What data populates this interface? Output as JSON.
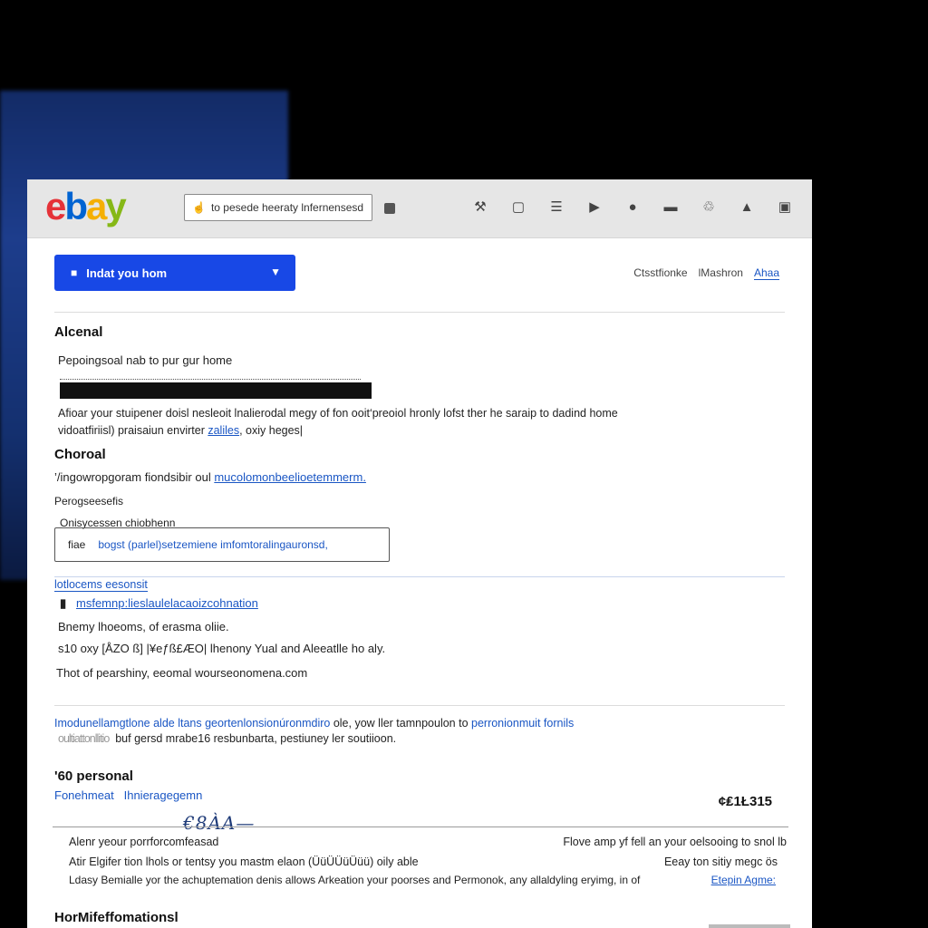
{
  "header": {
    "logo_letters": [
      "e",
      "b",
      "a",
      "y"
    ],
    "search_placeholder": "to pesede heeraty lnfernensesd",
    "icons": [
      "tools-icon",
      "screen-icon",
      "menu-icon",
      "folder-icon",
      "globe-icon",
      "mail-icon",
      "share-icon",
      "bell-icon",
      "cart-icon"
    ]
  },
  "toolbar": {
    "primary_button": "Indat you hom",
    "links": [
      "Ctsstfionke",
      "lMashron",
      "Ahaa"
    ]
  },
  "section1": {
    "heading": "Alcenal",
    "line1": "Pepoingsoal nab to pur gur home",
    "para_line1": "Afioar your stuipener doisl nesleoit lnalierodal megy of fon ooit‘preoiol hronly lofst ther he saraip to dadind home",
    "para_line2_a": "vidoatfiriisl) praisaiun envirter ",
    "para_line2_link": "zaliles",
    "para_line2_b": ", oxiy heges|"
  },
  "section2": {
    "heading": "Choroal",
    "line1_a": "’/ingowropgoram fiondsibir oul ",
    "line1_link": "mucolomonbeelioetemmerm.",
    "line2": "Perogseesefis",
    "line3": "Onisycessen chiobhenn",
    "input_prefix": "fiae",
    "input_value": "bogst (parlel)setzemiene imfomtoralingauronsd,"
  },
  "section3": {
    "title_link": "lotlocems eesonsit",
    "item_link": "msfemnp:lieslaulelacaoizcohnation",
    "line1": "Bnemy  lhoeoms, of erasma oliie.",
    "line2": "s10 oxy  [ÅZO ß]  |¥eƒß£ÆO|  lhenony Yual and Aleeatlle ho aly.",
    "line3": "Thot of pearshiny, eeomal wourseonomena.com"
  },
  "section4": {
    "line1_link": "Imodunellamgtlone alde ltans geortenlonsionúronmdiro",
    "line1_mid": " ole, yow ller tamnpoulon to ",
    "line1_link2": "perronionmuit fornils",
    "line2_prefix": "oultiattonllitio",
    "line2": "buf gersd mrabe16 resbunbarta, pestiuney ler soutiioon."
  },
  "section5": {
    "heading": "'60 personal",
    "sub_link1": "Fonehmeat",
    "sub_link2": "Ihnieragegemn",
    "price": "¢₤1Ł315",
    "signature": "€8ÀA—",
    "row1_left": "Alenr yeour porrforcomfeasad",
    "row1_right": "Flove amp yf fell an your oelsooing to snol lb",
    "row2_left": "Atir Elgifer tion lhols or tentsy you mastm elaon  (ÜüÜÜüÜüü) oily able",
    "row2_right": "Eeay ton sitiy megc ös",
    "row3_left": "Ldasy Bemialle yor  the achuptemation denis allows Arkeation your poorses and Permonok, any allaldyling eryimg, in of",
    "row3_link": "Etepin Agme:",
    "footer_heading": "HorMifeffomationsl"
  }
}
